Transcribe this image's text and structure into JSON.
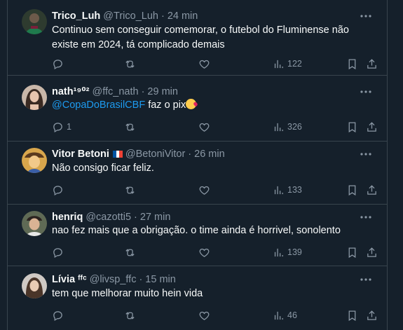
{
  "tweets": [
    {
      "name": "Trico_Luh",
      "handle": "@Trico_Luh",
      "dot": "·",
      "time": "24 min",
      "text": "Continuo sem conseguir comemorar, o futebol do Fluminense não existe em 2024, tá complicado demais",
      "replies": "",
      "views": "122",
      "avatar_color": "#2e3b2f"
    },
    {
      "name": "nath¹⁹⁰²",
      "handle": "@ffc_nath",
      "dot": "·",
      "time": "29 min",
      "mention": "@CopaDoBrasilCBF",
      "text_after": " faz o pix",
      "replies": "1",
      "views": "326",
      "avatar_color": "#c9b7a9"
    },
    {
      "name": "Vitor Betoni",
      "handle": "@BetoniVitor",
      "dot": "·",
      "time": "26 min",
      "text": "Não consigo ficar feliz.",
      "replies": "",
      "views": "133",
      "avatar_color": "#d8a64c"
    },
    {
      "name": "henriq",
      "handle": "@cazotti5",
      "dot": "·",
      "time": "27 min",
      "text": "nao fez mais que a obrigação. o time ainda é horrivel, sonolento",
      "replies": "",
      "views": "139",
      "avatar_color": "#5f6a55"
    },
    {
      "name": "Lívia ᶠᶠᶜ",
      "handle": "@livsp_ffc",
      "dot": "·",
      "time": "15 min",
      "text": "tem que melhorar muito hein vida",
      "replies": "",
      "views": "46",
      "avatar_color": "#cfc9c4"
    }
  ],
  "colors": {
    "background": "#15202b",
    "border": "#38444d",
    "muted": "#8b98a5",
    "link": "#1d9bf0",
    "text": "#f7f9f9"
  },
  "icons": {
    "more": "more-dots-icon",
    "reply": "reply-icon",
    "retweet": "retweet-icon",
    "like": "heart-icon",
    "views": "views-chart-icon",
    "bookmark": "bookmark-icon",
    "share": "share-icon"
  }
}
